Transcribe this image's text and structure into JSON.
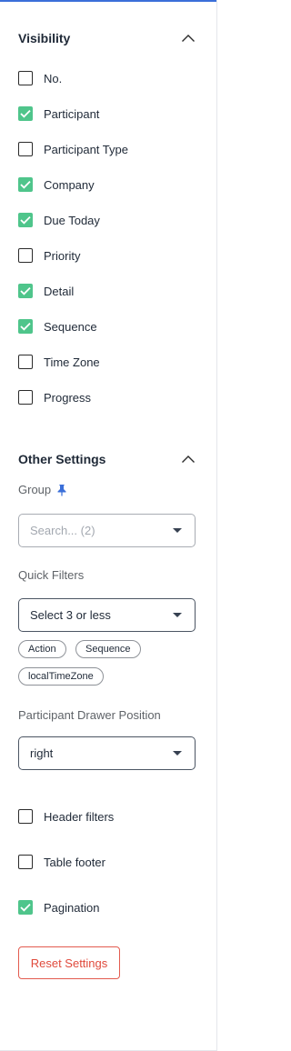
{
  "visibility": {
    "title": "Visibility",
    "items": [
      {
        "label": "No.",
        "checked": false
      },
      {
        "label": "Participant",
        "checked": true
      },
      {
        "label": "Participant Type",
        "checked": false
      },
      {
        "label": "Company",
        "checked": true
      },
      {
        "label": "Due Today",
        "checked": true
      },
      {
        "label": "Priority",
        "checked": false
      },
      {
        "label": "Detail",
        "checked": true
      },
      {
        "label": "Sequence",
        "checked": true
      },
      {
        "label": "Time Zone",
        "checked": false
      },
      {
        "label": "Progress",
        "checked": false
      }
    ]
  },
  "other_settings": {
    "title": "Other Settings",
    "group": {
      "label": "Group",
      "icon": "pin-icon",
      "placeholder": "Search... (2)"
    },
    "quick_filters": {
      "label": "Quick Filters",
      "placeholder": "Select 3 or less",
      "chips": [
        "Action",
        "Sequence",
        "localTimeZone"
      ]
    },
    "drawer_position": {
      "label": "Participant Drawer Position",
      "value": "right"
    },
    "toggles": [
      {
        "label": "Header filters",
        "checked": false
      },
      {
        "label": "Table footer",
        "checked": false
      },
      {
        "label": "Pagination",
        "checked": true
      }
    ],
    "reset_label": "Reset Settings"
  },
  "colors": {
    "accent": "#3b6fd9",
    "checkbox_checked": "#4fc58b",
    "danger": "#e04a3c"
  }
}
